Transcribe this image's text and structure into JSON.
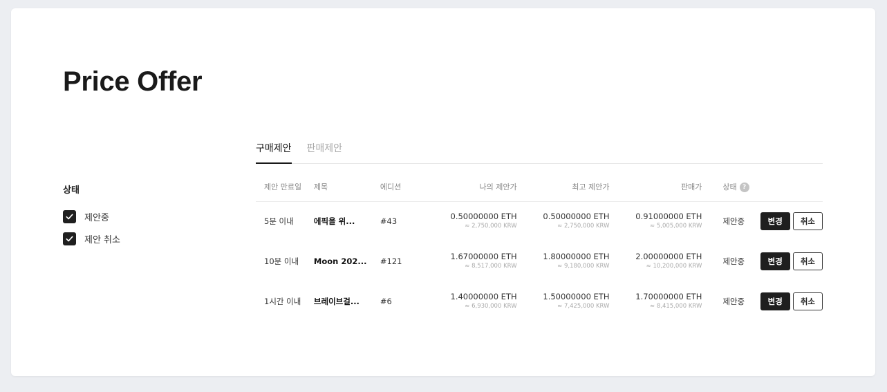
{
  "page": {
    "title": "Price Offer"
  },
  "filter": {
    "title": "상태",
    "items": [
      {
        "label": "제안중",
        "checked": true
      },
      {
        "label": "제안 취소",
        "checked": true
      }
    ]
  },
  "tabs": [
    {
      "label": "구매제안",
      "active": true
    },
    {
      "label": "판매제안",
      "active": false
    }
  ],
  "table": {
    "headers": {
      "expiry": "제안 만료일",
      "title": "제목",
      "edition": "에디션",
      "my_offer": "나의 제안가",
      "best_offer": "최고 제안가",
      "sell_price": "판매가",
      "status": "상태"
    },
    "help_icon": "?",
    "rows": [
      {
        "expiry": "5분 이내",
        "title": "에픽을 위...",
        "edition": "#43",
        "my_eth": "0.50000000 ETH",
        "my_krw": "≈ 2,750,000 KRW",
        "best_eth": "0.50000000 ETH",
        "best_krw": "≈ 2,750,000 KRW",
        "sell_eth": "0.91000000 ETH",
        "sell_krw": "≈ 5,005,000 KRW",
        "status": "제안중",
        "change_label": "변경",
        "cancel_label": "취소"
      },
      {
        "expiry": "10분 이내",
        "title": "Moon 202...",
        "edition": "#121",
        "my_eth": "1.67000000 ETH",
        "my_krw": "≈ 8,517,000 KRW",
        "best_eth": "1.80000000 ETH",
        "best_krw": "≈ 9,180,000 KRW",
        "sell_eth": "2.00000000 ETH",
        "sell_krw": "≈ 10,200,000 KRW",
        "status": "제안중",
        "change_label": "변경",
        "cancel_label": "취소"
      },
      {
        "expiry": "1시간 이내",
        "title": "브레이브걸...",
        "edition": "#6",
        "my_eth": "1.40000000 ETH",
        "my_krw": "≈ 6,930,000 KRW",
        "best_eth": "1.50000000 ETH",
        "best_krw": "≈ 7,425,000 KRW",
        "sell_eth": "1.70000000 ETH",
        "sell_krw": "≈ 8,415,000 KRW",
        "status": "제안중",
        "change_label": "변경",
        "cancel_label": "취소"
      }
    ]
  },
  "colors": {
    "background": "#eceef2",
    "card": "#ffffff",
    "primary_dark": "#1f1f1f",
    "muted_text": "#aaaaaa"
  }
}
